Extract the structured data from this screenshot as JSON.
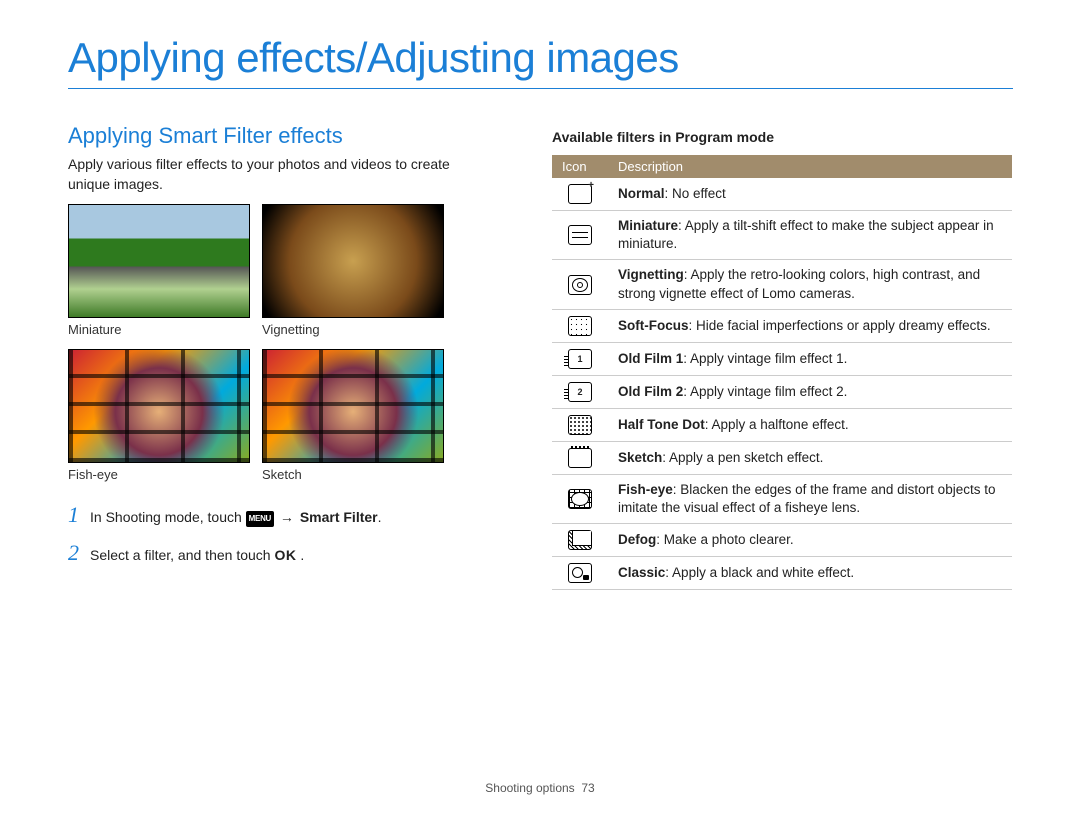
{
  "page_title": "Applying effects/Adjusting images",
  "section_title": "Applying Smart Filter effects",
  "intro": "Apply various filter effects to your photos and videos to create unique images.",
  "samples": [
    {
      "label": "Miniature",
      "css": "miniature"
    },
    {
      "label": "Vignetting",
      "css": "vignetting"
    },
    {
      "label": "Fish-eye",
      "css": "fisheye"
    },
    {
      "label": "Sketch",
      "css": "sketch"
    }
  ],
  "steps": {
    "s1_pre": "In Shooting mode, touch ",
    "s1_menu": "MENU",
    "s1_arrow": " → ",
    "s1_bold": "Smart Filter",
    "s1_post": ".",
    "s2_pre": "Select a filter, and then touch ",
    "s2_ok": "OK",
    "s2_post": " ."
  },
  "right_heading": "Available filters in Program mode",
  "table_headers": {
    "icon": "Icon",
    "desc": "Description"
  },
  "filters": [
    {
      "icon": "normal",
      "name": "Normal",
      "desc": ": No effect"
    },
    {
      "icon": "miniature",
      "name": "Miniature",
      "desc": ": Apply a tilt-shift effect to make the subject appear in miniature."
    },
    {
      "icon": "vignetting",
      "name": "Vignetting",
      "desc": ": Apply the retro-looking colors, high contrast, and strong vignette effect of Lomo cameras."
    },
    {
      "icon": "softfocus",
      "name": "Soft-Focus",
      "desc": ": Hide facial imperfections or apply dreamy effects."
    },
    {
      "icon": "oldfilm1",
      "name": "Old Film 1",
      "desc": ": Apply vintage film effect 1."
    },
    {
      "icon": "oldfilm2",
      "name": "Old Film 2",
      "desc": ": Apply vintage film effect 2."
    },
    {
      "icon": "halftone",
      "name": "Half Tone Dot",
      "desc": ": Apply a halftone effect."
    },
    {
      "icon": "sketch",
      "name": "Sketch",
      "desc": ": Apply a pen sketch effect."
    },
    {
      "icon": "fisheye",
      "name": "Fish-eye",
      "desc": ": Blacken the edges of the frame and distort objects to imitate the visual effect of a fisheye lens."
    },
    {
      "icon": "defog",
      "name": "Defog",
      "desc": ": Make a photo clearer."
    },
    {
      "icon": "classic",
      "name": "Classic",
      "desc": ": Apply a black and white effect."
    }
  ],
  "footer": {
    "section": "Shooting options",
    "page": "73"
  }
}
